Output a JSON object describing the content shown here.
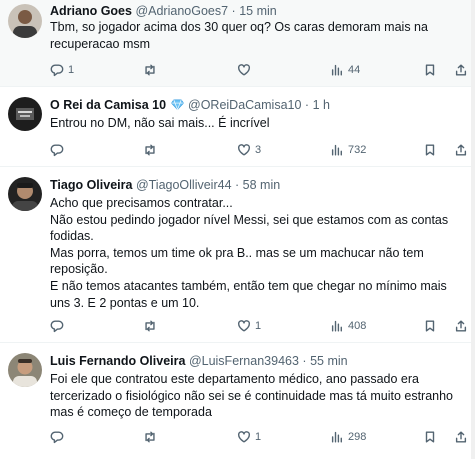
{
  "tweets": [
    {
      "name": "Adriano Goes",
      "handle": "@AdrianoGoes7",
      "dot": "·",
      "time": "15 min",
      "lines": [
        "Tbm, so  jogador acima dos 30 quer oq? Os caras demoram mais na",
        "recuperacao msm"
      ],
      "replies": "1",
      "retweets": "",
      "likes": "",
      "views": "44"
    },
    {
      "name": "O Rei da Camisa 10",
      "handle": "@OReiDaCamisa10",
      "dot": "·",
      "time": "1 h",
      "lines": [
        "Entrou no DM, não sai mais... É incrível"
      ],
      "replies": "",
      "retweets": "",
      "likes": "3",
      "views": "732"
    },
    {
      "name": "Tiago Oliveira",
      "handle": "@TiagoOlliveir44",
      "dot": "·",
      "time": "58 min",
      "lines": [
        "Acho que precisamos contratar...",
        "Não estou pedindo jogador nível Messi, sei que estamos com as contas",
        "fodidas.",
        "Mas porra, temos um time ok pra B.. mas se um machucar não tem",
        "reposição.",
        "E não temos atacantes também, então tem que chegar no mínimo mais",
        "uns 3. E 2 pontas e um 10."
      ],
      "replies": "",
      "retweets": "",
      "likes": "1",
      "views": "408"
    },
    {
      "name": "Luis Fernando Oliveira",
      "handle": "@LuisFernan39463",
      "dot": "·",
      "time": "55 min",
      "lines": [
        "Foi ele que contratou este departamento médico, ano passado era",
        "tercerizado o fisiológico não sei se é continuidade mas tá muito estranho",
        "mas é começo de temporada"
      ],
      "replies": "",
      "retweets": "",
      "likes": "1",
      "views": "298"
    }
  ],
  "icons": {
    "reply": "reply-icon",
    "retweet": "retweet-icon",
    "like": "heart-icon",
    "views": "views-icon",
    "bookmark": "bookmark-icon",
    "share": "share-icon",
    "verified": "verified-diamond-icon"
  },
  "colors": {
    "text": "#0f1419",
    "secondary": "#536471",
    "hover_bg": "#f7f9f9",
    "verified": "#6cc3f5"
  }
}
